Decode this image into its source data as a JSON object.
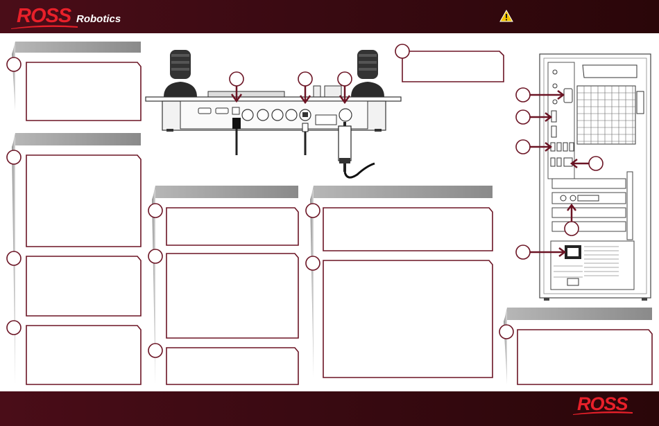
{
  "header": {
    "logo_text": "ROSS",
    "logo_subtext": "Robotics",
    "warning_icon": "warning-triangle-icon"
  },
  "footer": {
    "logo_text": "ROSS"
  },
  "colors": {
    "bar": "#3a0a12",
    "logo_red": "#e8202a",
    "callout_stroke": "#6b1424",
    "tab_gray": "#8f8f8f"
  },
  "left_column": {
    "panels": [
      {
        "tab": "",
        "steps": [
          ""
        ]
      },
      {
        "tab": "",
        "steps": [
          "",
          "",
          ""
        ]
      }
    ]
  },
  "middle_column": {
    "panels": [
      {
        "tab": "",
        "steps": [
          "",
          "",
          ""
        ]
      }
    ]
  },
  "right_column": {
    "panels": [
      {
        "tab": "",
        "steps": [
          "",
          ""
        ]
      }
    ]
  },
  "pc_panel": {
    "tab": "",
    "steps": [
      ""
    ],
    "rear_callouts": [
      "",
      "",
      "",
      "",
      "",
      ""
    ]
  },
  "controller_callouts": [
    "",
    "",
    "",
    ""
  ]
}
